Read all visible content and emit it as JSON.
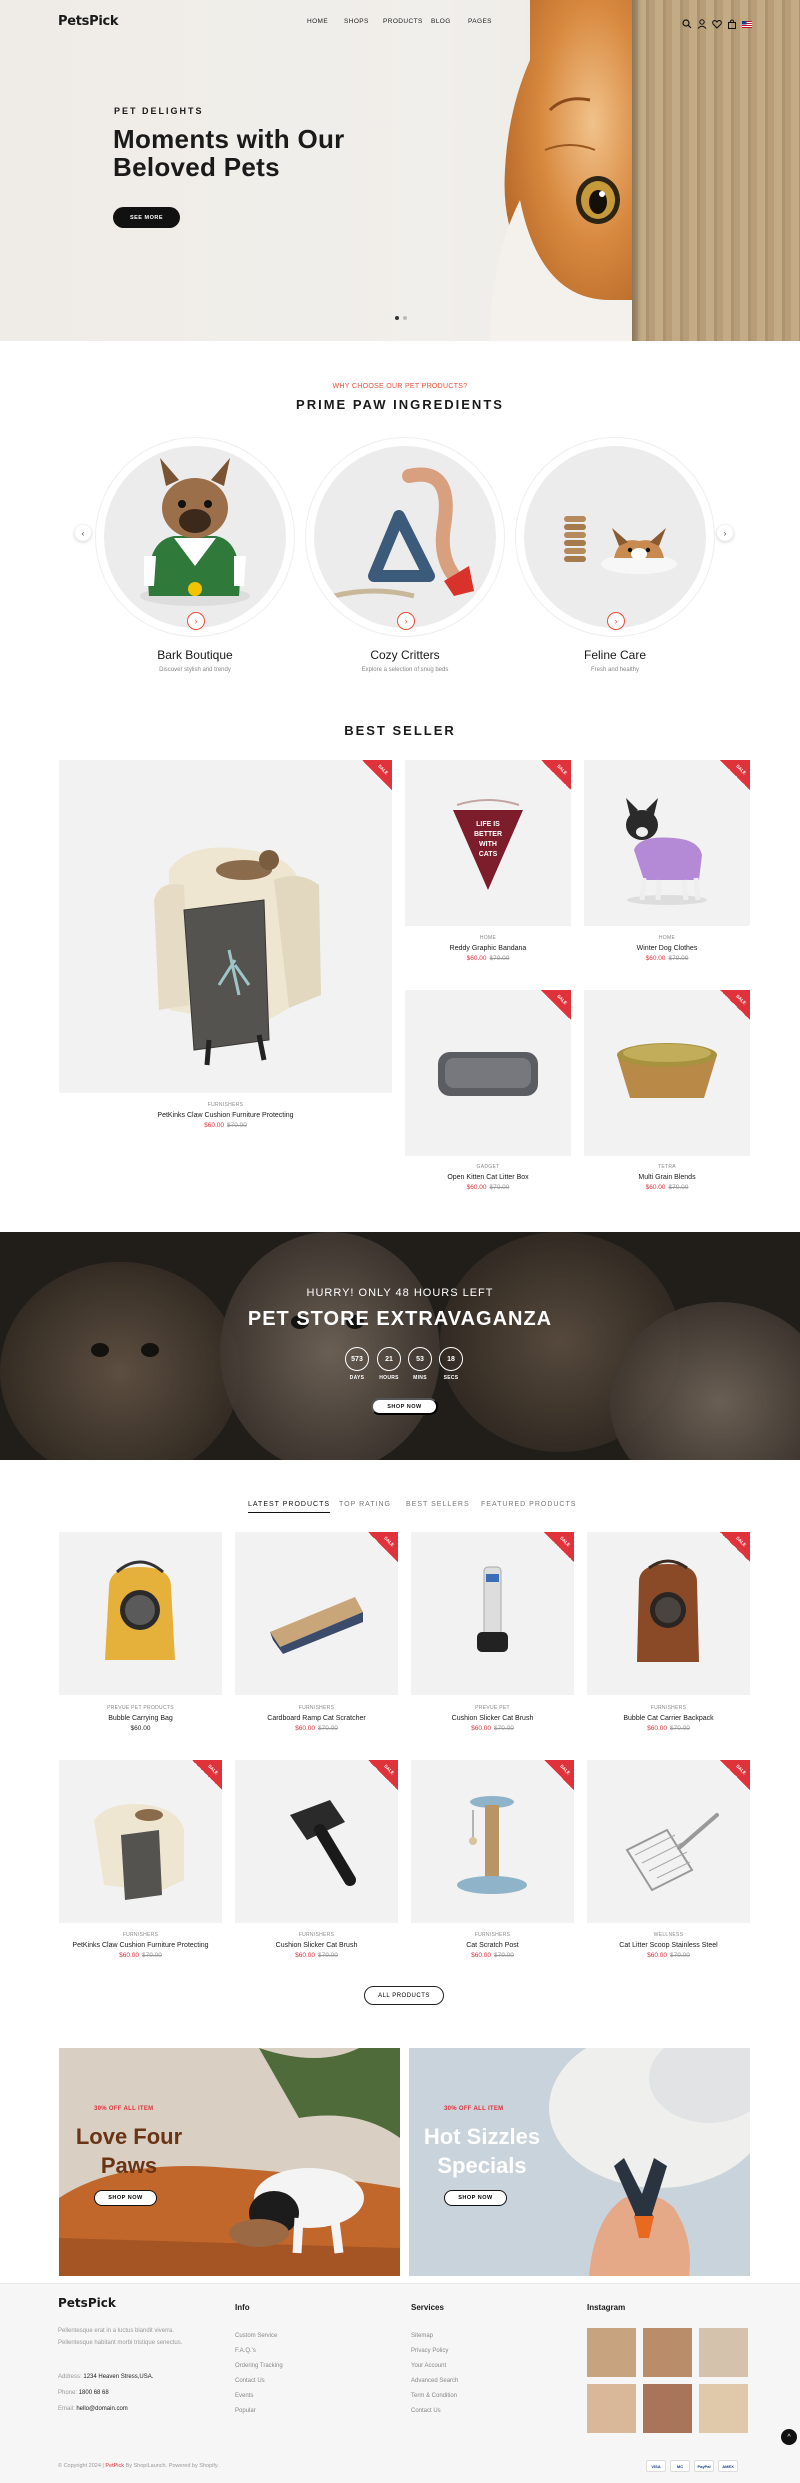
{
  "header": {
    "logo": "PetsPick",
    "nav": [
      "HOME",
      "SHOPS",
      "PRODUCTS",
      "BLOG",
      "PAGES"
    ],
    "cart_count": "0"
  },
  "hero": {
    "kicker": "PET DELIGHTS",
    "title": "Moments with Our Beloved Pets",
    "button": "SEE MORE"
  },
  "why": {
    "kicker": "WHY CHOOSE OUR PET PRODUCTS?",
    "title": "PRIME PAW INGREDIENTS",
    "categories": [
      {
        "name": "Bark Boutique",
        "desc": "Discover stylish and trendy"
      },
      {
        "name": "Cozy Critters",
        "desc": "Explore a selection of snug beds"
      },
      {
        "name": "Feline Care",
        "desc": "Fresh and healthy"
      }
    ]
  },
  "best_seller": {
    "title": "BEST SELLER",
    "sale_label": "SALE",
    "featured": {
      "cat": "FURNISHERS",
      "name": "PetKinks Claw Cushion Furniture Protecting",
      "price": "$60.00",
      "old": "$70.00"
    },
    "products": [
      {
        "cat": "HOME",
        "name": "Reddy Graphic Bandana",
        "price": "$60.00",
        "old": "$70.00"
      },
      {
        "cat": "HOME",
        "name": "Winter Dog Clothes",
        "price": "$60.00",
        "old": "$70.00"
      },
      {
        "cat": "GADGET",
        "name": "Open Kitten Cat Litter Box",
        "price": "$60.00",
        "old": "$70.00"
      },
      {
        "cat": "TETRA",
        "name": "Multi Grain Blends",
        "price": "$60.00",
        "old": "$70.00"
      }
    ],
    "bandana_text": "LIFE IS BETTER WITH CATS"
  },
  "promo": {
    "kicker": "HURRY! ONLY 48 HOURS LEFT",
    "title": "PET STORE EXTRAVAGANZA",
    "countdown": [
      {
        "num": "573",
        "label": "DAYS"
      },
      {
        "num": "21",
        "label": "HOURS"
      },
      {
        "num": "53",
        "label": "MINS"
      },
      {
        "num": "18",
        "label": "SECS"
      }
    ],
    "button": "SHOP NOW"
  },
  "tabs": {
    "items": [
      "LATEST PRODUCTS",
      "TOP RATING",
      "BEST SELLERS",
      "FEATURED PRODUCTS"
    ],
    "active": "LATEST PRODUCTS"
  },
  "latest": {
    "products": [
      {
        "cat": "PREVUE PET PRODUCTS",
        "name": "Bubble Carrying Bag",
        "price": "$60.00",
        "old": ""
      },
      {
        "cat": "FURNISHERS",
        "name": "Cardboard Ramp Cat Scratcher",
        "price": "$60.00",
        "old": "$70.00"
      },
      {
        "cat": "PREVUE PET",
        "name": "Cushion Slicker Cat Brush",
        "price": "$60.00",
        "old": "$70.00"
      },
      {
        "cat": "FURNISHERS",
        "name": "Bubble Cat Carrier Backpack",
        "price": "$60.00",
        "old": "$70.00"
      },
      {
        "cat": "FURNISHERS",
        "name": "PetKinks Claw Cushion Furniture Protecting",
        "price": "$60.00",
        "old": "$70.00"
      },
      {
        "cat": "FURNISHERS",
        "name": "Cushion Slicker Cat Brush",
        "price": "$60.00",
        "old": "$70.00"
      },
      {
        "cat": "FURNISHERS",
        "name": "Cat Scratch Post",
        "price": "$60.00",
        "old": "$70.00"
      },
      {
        "cat": "WELLNESS",
        "name": "Cat Litter Scoop Stainless Steel",
        "price": "$60.00",
        "old": "$70.00"
      }
    ],
    "all_button": "ALL PRODUCTS"
  },
  "banners": [
    {
      "kicker": "30% OFF ALL ITEM",
      "title": "Love Four Paws",
      "button": "SHOP NOW"
    },
    {
      "kicker": "30% OFF ALL ITEM",
      "title": "Hot Sizzles Specials",
      "button": "SHOP NOW"
    }
  ],
  "footer": {
    "logo": "PetsPick",
    "desc": "Pellentesque erat in a luctus blandit viverra. Pellentesque habitant morbi tristique senectus.",
    "address_label": "Address:",
    "address": "1234 Heaven Stress,USA.",
    "phone_label": "Phone:",
    "phone": "1800 68 68",
    "email_label": "Email:",
    "email": "hello@domain.com",
    "info_head": "Info",
    "info_links": [
      "Custom Service",
      "F.A.Q.'s",
      "Ordering Tracking",
      "Contact Us",
      "Events",
      "Popular"
    ],
    "services_head": "Services",
    "services_links": [
      "Sitemap",
      "Privacy Policy",
      "Your Account",
      "Advanced Search",
      "Term & Condition",
      "Contact Us"
    ],
    "insta_head": "Instagram",
    "copyright_pre": "© Copyright 2024 |",
    "copyright_brand": "PetPick",
    "copyright_mid": "By ShopiLaunch.",
    "copyright_post": "Powered by Shopify.",
    "payments": [
      "VISA",
      "MC",
      "PayPal",
      "AMEX"
    ]
  },
  "colors": {
    "accent": "#e0323a",
    "kicker": "#e8503a",
    "dark": "#111111"
  }
}
